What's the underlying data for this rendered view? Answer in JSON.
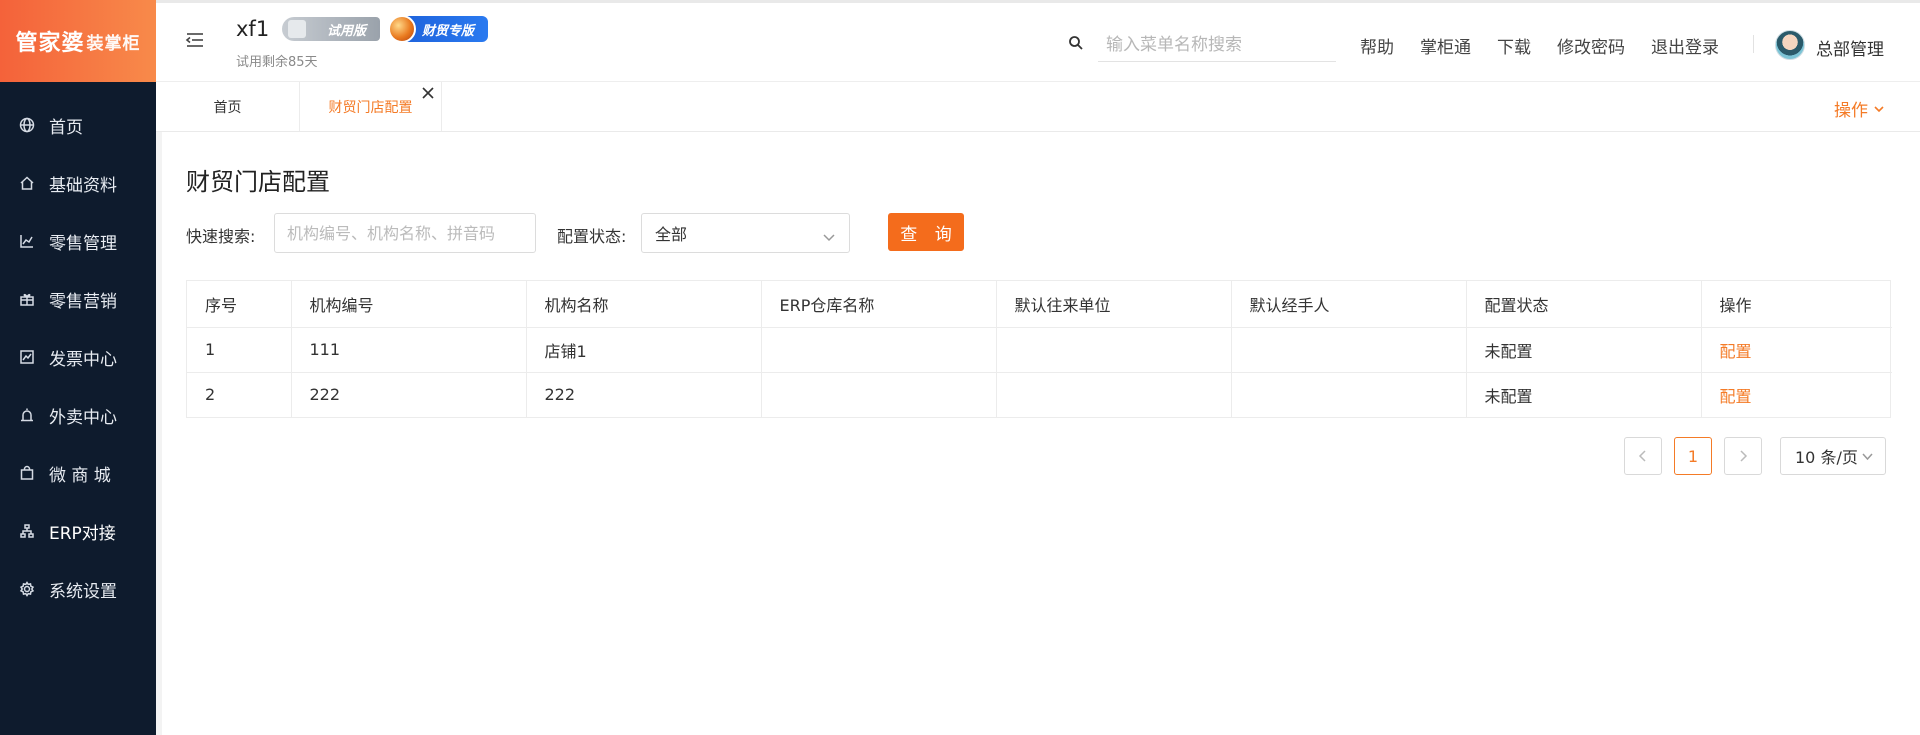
{
  "app": {
    "logo_main": "管家婆",
    "logo_sub": "装掌柜"
  },
  "sidebar": {
    "items": [
      {
        "label": "首页",
        "icon": "globe-icon"
      },
      {
        "label": "基础资料",
        "icon": "home-icon"
      },
      {
        "label": "零售管理",
        "icon": "bar-chart-icon"
      },
      {
        "label": "零售营销",
        "icon": "gift-icon"
      },
      {
        "label": "发票中心",
        "icon": "line-chart-icon"
      },
      {
        "label": "外卖中心",
        "icon": "alarm-icon"
      },
      {
        "label": "微 商 城",
        "icon": "bag-icon"
      },
      {
        "label": "ERP对接",
        "icon": "sitemap-icon"
      },
      {
        "label": "系统设置",
        "icon": "gear-icon"
      }
    ],
    "active_index": 7
  },
  "header": {
    "company": "xf1",
    "trial_badge": "试用版",
    "finance_badge": "财贸专版",
    "trial_days": "试用剩余85天",
    "search_placeholder": "输入菜单名称搜索",
    "links": [
      "帮助",
      "掌柜通",
      "下载",
      "修改密码",
      "退出登录"
    ],
    "user_name": "总部管理"
  },
  "tabs": {
    "home": "首页",
    "active": "财贸门店配置",
    "ops": "操作"
  },
  "main": {
    "title": "财贸门店配置",
    "quick_search_label": "快速搜索:",
    "quick_search_placeholder": "机构编号、机构名称、拼音码",
    "status_label": "配置状态:",
    "status_value": "全部",
    "query_button": "查 询"
  },
  "table": {
    "columns": [
      "序号",
      "机构编号",
      "机构名称",
      "ERP仓库名称",
      "默认往来单位",
      "默认经手人",
      "配置状态",
      "操作"
    ],
    "rows": [
      {
        "no": "1",
        "code": "111",
        "name": "店铺1",
        "erp": "",
        "unit": "",
        "handler": "",
        "status": "未配置",
        "action": "配置"
      },
      {
        "no": "2",
        "code": "222",
        "name": "222",
        "erp": "",
        "unit": "",
        "handler": "",
        "status": "未配置",
        "action": "配置"
      }
    ]
  },
  "pagination": {
    "current": "1",
    "page_size": "10 条/页"
  },
  "colors": {
    "accent": "#f47b27",
    "sidebar_bg": "#0e1b2d",
    "button": "#f46c1c"
  }
}
